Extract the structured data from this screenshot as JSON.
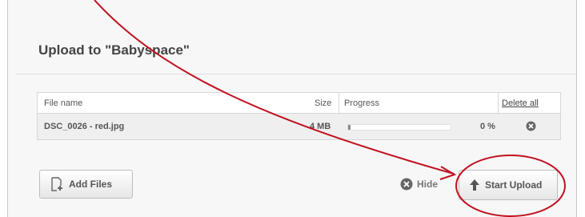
{
  "dialog": {
    "title": "Upload to \"Babyspace\""
  },
  "table": {
    "headers": {
      "file_name": "File name",
      "size": "Size",
      "progress": "Progress",
      "delete_all": "Delete all"
    },
    "rows": [
      {
        "file_name": "DSC_0026 - red.jpg",
        "size": "4 MB",
        "progress_fraction": 0,
        "progress_label": "0 %",
        "delete_icon": "delete-circle-x-icon"
      }
    ]
  },
  "buttons": {
    "add_files": "Add Files",
    "hide": "Hide",
    "start_upload": "Start Upload"
  },
  "icons": {
    "add_files": "add-file-icon",
    "hide": "close-circle-icon",
    "start_upload": "up-arrow-icon"
  },
  "annotation": {
    "color": "#c0111f"
  }
}
